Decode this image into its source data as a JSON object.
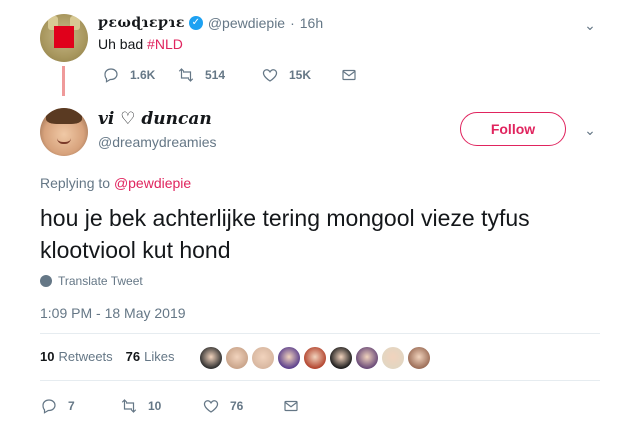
{
  "parent_tweet": {
    "display_name": "ƿɛωɖɿɛƿɿɛ",
    "handle": "@pewdiepie",
    "separator": "·",
    "time": "16h",
    "text": "Uh bad",
    "hashtag": "#NLD",
    "reply_count": "1.6K",
    "retweet_count": "514",
    "like_count": "15K"
  },
  "main_tweet": {
    "display_name": "vi ♡ duncan",
    "handle": "@dreamydreamies",
    "follow_label": "Follow",
    "replying_prefix": "Replying to",
    "replying_mention": "@pewdiepie",
    "text": "hou je bek achterlijke tering mongool vieze tyfus klootviool kut hond",
    "translate_label": "Translate Tweet",
    "timestamp": "1:09 PM - 18 May 2019",
    "retweets_count": "10",
    "retweets_label": "Retweets",
    "likes_count": "76",
    "likes_label": "Likes",
    "reply_count": "7",
    "retweet_count": "10",
    "like_count": "76"
  },
  "liker_avatar_colors": [
    "#2f2f2f",
    "#c9a48a",
    "#d8b7a0",
    "#5b3f8c",
    "#b3452f",
    "#1c1c1c",
    "#6a4a78",
    "#e2d6c2",
    "#9c6e58"
  ],
  "colors": {
    "accent": "#e0245e",
    "muted": "#657786",
    "text": "#14171a",
    "verified": "#1da1f2"
  }
}
